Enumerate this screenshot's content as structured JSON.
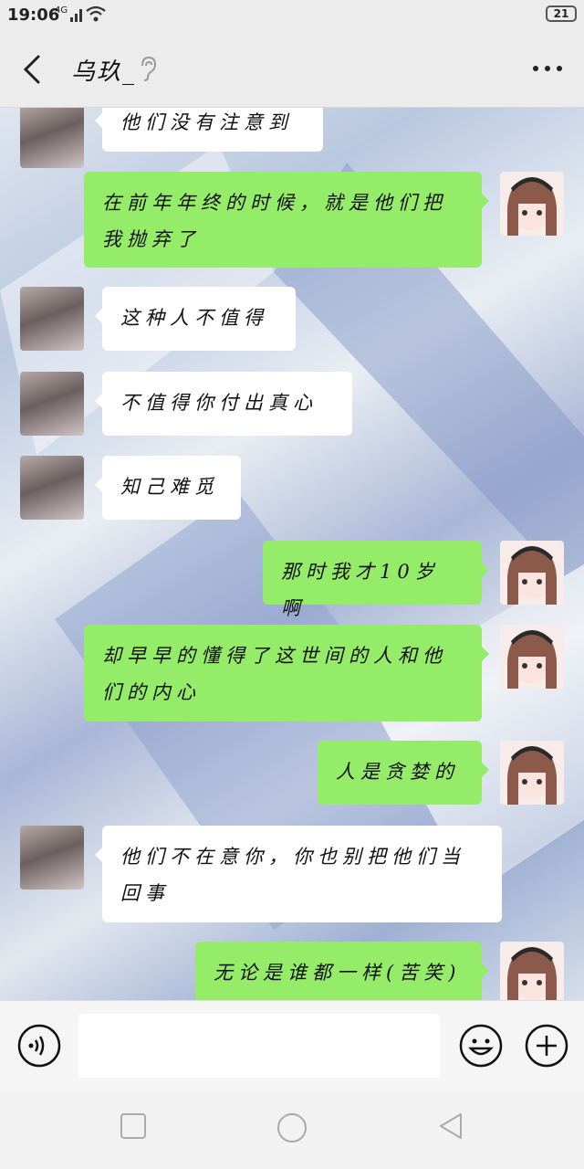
{
  "status_bar": {
    "time": "19:06",
    "signal": "4G",
    "battery": "21"
  },
  "header": {
    "title": "乌玖_",
    "back_icon": "chevron-left-icon",
    "more_icon": "more-dots-icon",
    "ear_icon": "ear-icon"
  },
  "messages": [
    {
      "side": "in",
      "text": "他们没有注意到"
    },
    {
      "side": "out",
      "text": "在前年年终的时候，就是他们把我抛弃了"
    },
    {
      "side": "in",
      "text": "这种人不值得"
    },
    {
      "side": "in",
      "text": "不值得你付出真心"
    },
    {
      "side": "in",
      "text": "知己难觅"
    },
    {
      "side": "out",
      "text": "那时我才10岁啊"
    },
    {
      "side": "out",
      "text": "却早早的懂得了这世间的人和他们的内心"
    },
    {
      "side": "out",
      "text": "人是贪婪的"
    },
    {
      "side": "in",
      "text": "他们不在意你，你也别把他们当回事"
    },
    {
      "side": "out",
      "text": "无论是谁都一样(苦笑)"
    }
  ],
  "input_bar": {
    "placeholder": "",
    "voice_icon": "voice-icon",
    "emoji_icon": "emoji-icon",
    "plus_icon": "plus-icon"
  },
  "nav_bar": {
    "icons": [
      "square-icon",
      "circle-icon",
      "triangle-back-icon"
    ]
  },
  "colors": {
    "bubble_out": "#95ec69",
    "bubble_in": "#ffffff",
    "header_bg": "#ececec"
  }
}
